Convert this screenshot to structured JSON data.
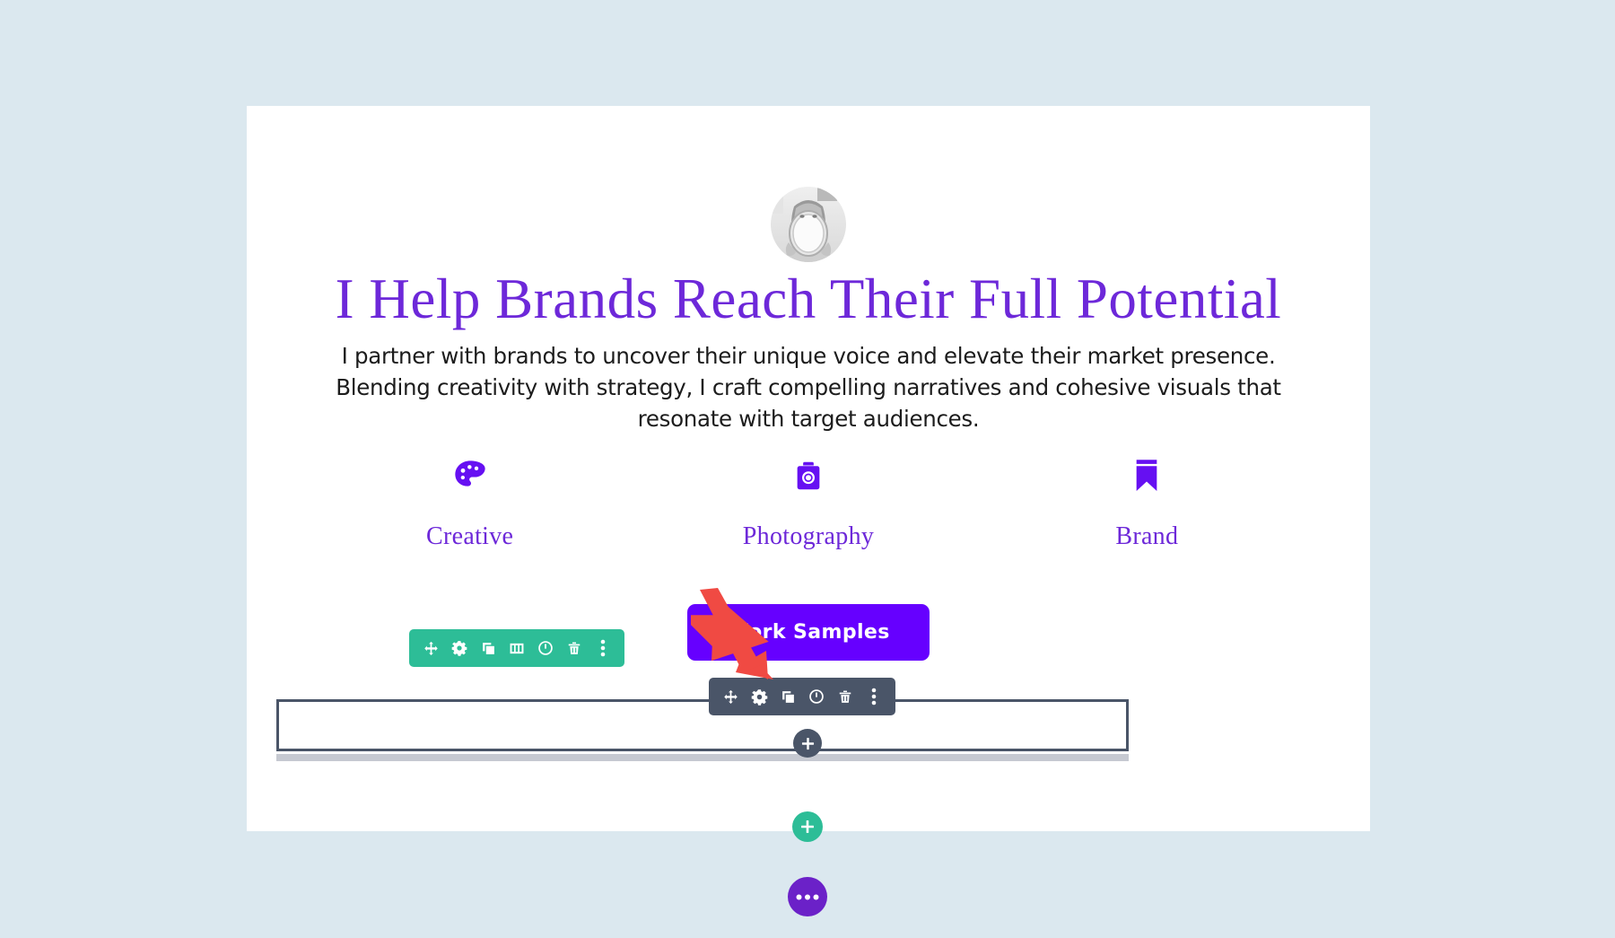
{
  "theme": {
    "page_background": "#dbe8ef",
    "card_background": "#ffffff",
    "accent_purple": "#6600ff",
    "heading_purple": "#6d28d9",
    "toolbar_teal": "#2dbd97",
    "toolbar_dark": "#4a5568",
    "annotation_red": "#f04a43"
  },
  "page": {
    "avatar": {
      "name": "profile-photo",
      "alt": "Portrait photo of a person holding an oval mirror"
    },
    "headline": "I Help Brands Reach Their Full Potential",
    "paragraph": [
      "I partner with brands to uncover their unique voice and elevate their market presence.",
      "Blending creativity with strategy, I craft compelling narratives and cohesive visuals that",
      "resonate with target audiences."
    ],
    "features": [
      {
        "icon": "palette-icon",
        "label": "Creative"
      },
      {
        "icon": "camera-icon",
        "label": "Photography"
      },
      {
        "icon": "bookmark-icon",
        "label": "Brand"
      }
    ],
    "cta_button": {
      "label": "Work Samples"
    }
  },
  "toolbars": {
    "module_toolbar": {
      "name": "module-settings-toolbar",
      "color": "#2dbd97",
      "buttons": [
        {
          "icon": "move-icon",
          "label": "Move"
        },
        {
          "icon": "gear-icon",
          "label": "Settings"
        },
        {
          "icon": "duplicate-icon",
          "label": "Duplicate"
        },
        {
          "icon": "columns-icon",
          "label": "Columns"
        },
        {
          "icon": "power-icon",
          "label": "Disable"
        },
        {
          "icon": "trash-icon",
          "label": "Delete"
        },
        {
          "icon": "dots-vertical-icon",
          "label": "More options"
        }
      ]
    },
    "row_toolbar": {
      "name": "row-settings-toolbar",
      "color": "#4a5568",
      "buttons": [
        {
          "icon": "move-icon",
          "label": "Move"
        },
        {
          "icon": "gear-icon",
          "label": "Settings"
        },
        {
          "icon": "duplicate-icon",
          "label": "Duplicate"
        },
        {
          "icon": "power-icon",
          "label": "Disable"
        },
        {
          "icon": "trash-icon",
          "label": "Delete"
        },
        {
          "icon": "dots-vertical-icon",
          "label": "More options"
        }
      ]
    }
  },
  "add_controls": [
    {
      "name": "add-module-button",
      "icon": "plus-icon",
      "color": "#4a5568",
      "label": "+"
    },
    {
      "name": "add-row-button",
      "icon": "plus-icon",
      "color": "#2dbd97",
      "label": "+"
    },
    {
      "name": "builder-menu-button",
      "icon": "dots-horizontal-icon",
      "color": "#6b21c8",
      "label": "..."
    }
  ],
  "annotation": {
    "name": "red-pointer-arrow",
    "color": "#f04a43",
    "points_to": "gear-icon"
  }
}
